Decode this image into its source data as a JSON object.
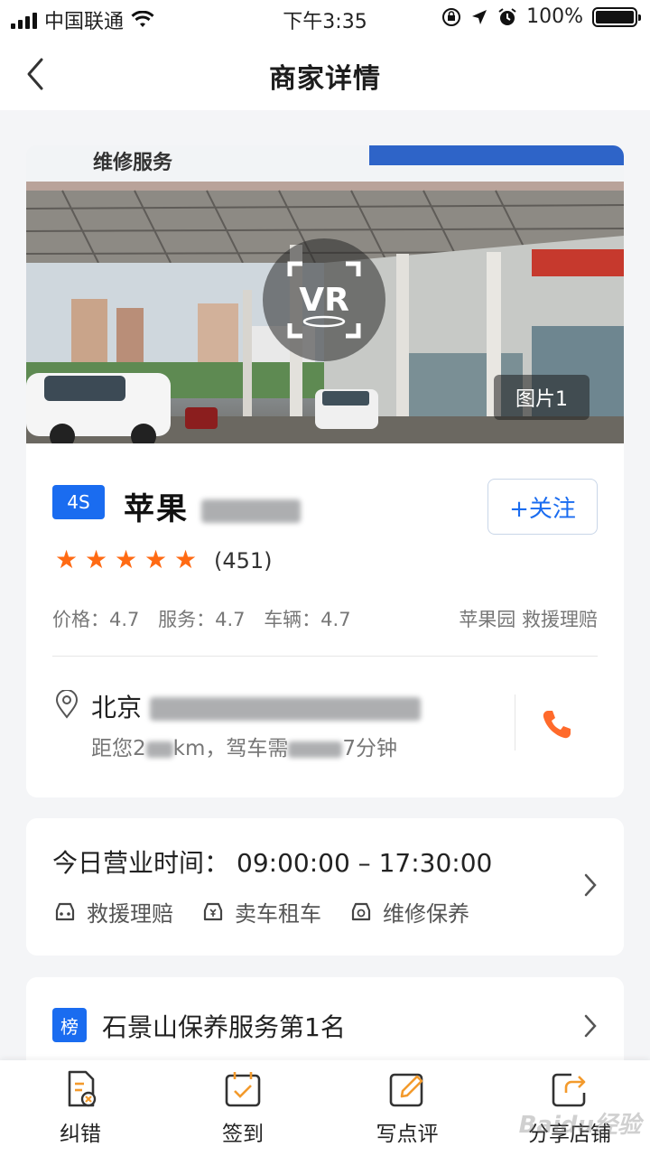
{
  "status_bar": {
    "carrier": "中国联通",
    "time": "下午3:35",
    "battery": "100%",
    "battery_level": 1.0
  },
  "nav": {
    "title": "商家详情"
  },
  "store": {
    "image_label": "图片1",
    "vr_label": "VR",
    "photo_sign": "维修服务",
    "type_badge": "4S",
    "name_visible": "苹果",
    "follow_label": "+关注",
    "rating_stars": 5,
    "review_count": "(451)",
    "scores": [
      "价格：4.7",
      "服务：4.7",
      "车辆：4.7"
    ],
    "tags": "苹果园 救援理赔",
    "address_visible": "北京",
    "distance_prefix": "距您2",
    "distance_mid": "km，驾车需",
    "distance_suffix": "7分钟"
  },
  "hours": {
    "label": "今日营业时间：",
    "time": "09:00:00 – 17:30:00",
    "services": [
      "救援理赔",
      "卖车租车",
      "维修保养"
    ]
  },
  "ranking": {
    "badge": "榜",
    "text": "石景山保养服务第1名"
  },
  "bottom_bar": {
    "items": [
      "纠错",
      "签到",
      "写点评",
      "分享店铺"
    ]
  },
  "watermark": "Baidu经验",
  "colors": {
    "accent": "#1a6cf0",
    "star": "#ff6a13",
    "phone": "#ff6a2b",
    "icon_orange": "#f39a2c"
  }
}
